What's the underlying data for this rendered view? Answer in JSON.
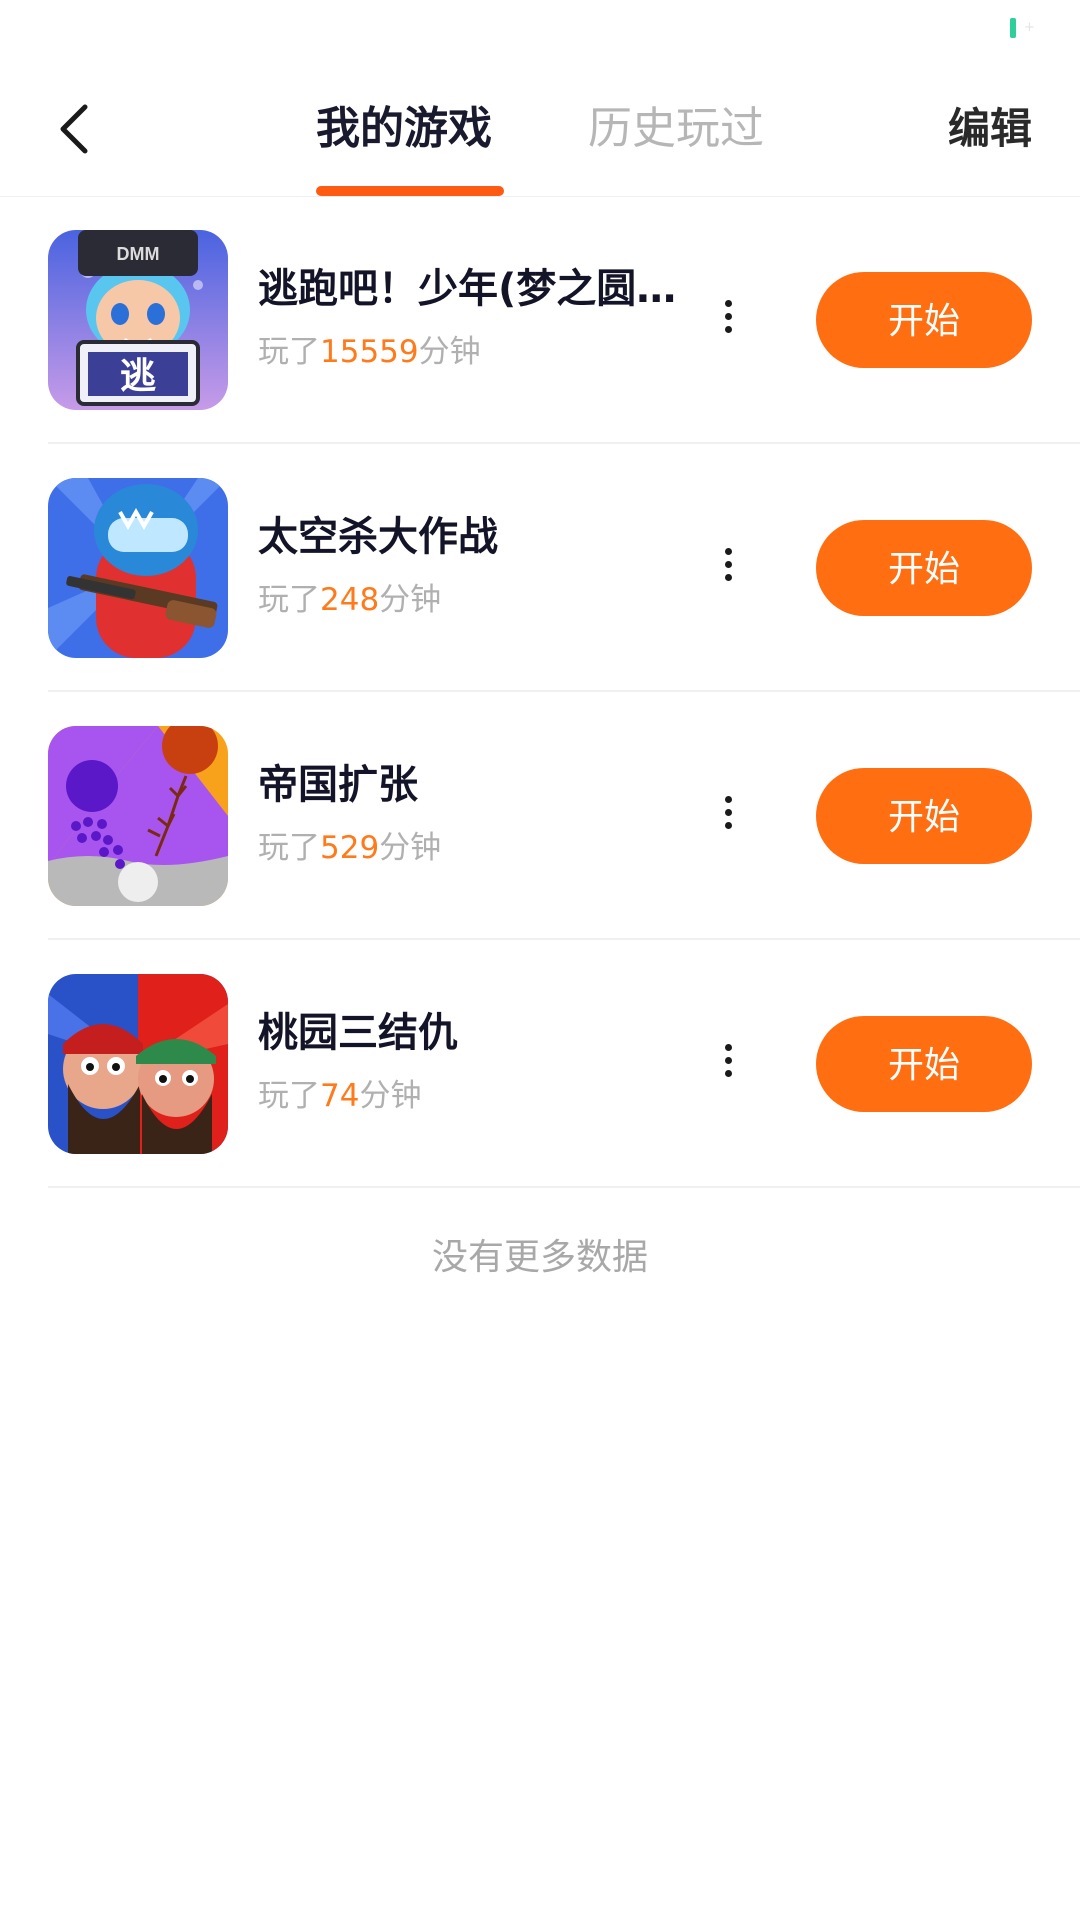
{
  "header": {
    "tabs": [
      {
        "label": "我的游戏",
        "active": true
      },
      {
        "label": "历史玩过",
        "active": false
      }
    ],
    "edit_label": "编辑",
    "back_icon": "chevron-left-icon"
  },
  "colors": {
    "accent": "#ff6f12",
    "tab_indicator": "#ff5a12",
    "playtime_number": "#ff7a1a",
    "battery": "#2ecf9a"
  },
  "games": [
    {
      "title": "逃跑吧！少年(梦之圆...",
      "playtime_prefix": "玩了",
      "playtime_minutes": "15559",
      "playtime_suffix": "分钟",
      "start_label": "开始"
    },
    {
      "title": "太空杀大作战",
      "playtime_prefix": "玩了",
      "playtime_minutes": "248",
      "playtime_suffix": "分钟",
      "start_label": "开始"
    },
    {
      "title": "帝国扩张",
      "playtime_prefix": "玩了",
      "playtime_minutes": "529",
      "playtime_suffix": "分钟",
      "start_label": "开始"
    },
    {
      "title": "桃园三结仇",
      "playtime_prefix": "玩了",
      "playtime_minutes": "74",
      "playtime_suffix": "分钟",
      "start_label": "开始"
    }
  ],
  "icon_text": {
    "game0_cap": "DMM",
    "game0_sign": "逃"
  },
  "footer": {
    "no_more_text": "没有更多数据"
  }
}
